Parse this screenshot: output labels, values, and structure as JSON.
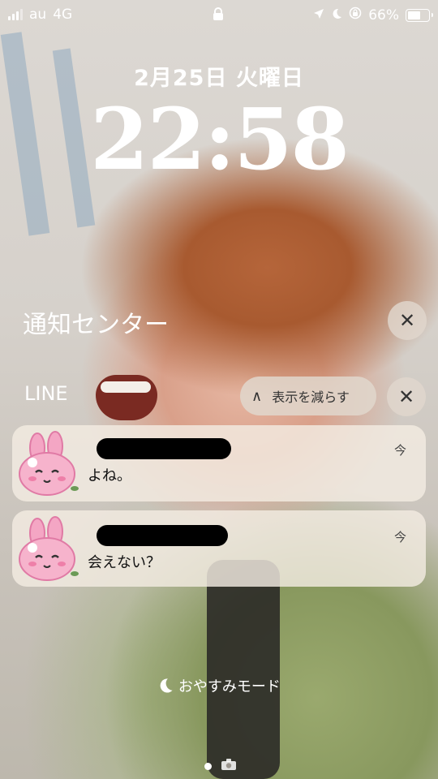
{
  "status_bar": {
    "carrier": "au",
    "network": "4G",
    "battery_percent": "66%",
    "battery_level": 0.66,
    "icons": [
      "signal-bars-icon",
      "lock-icon",
      "location-arrow-icon",
      "moon-icon",
      "rotation-lock-icon",
      "battery-icon"
    ]
  },
  "lock_screen": {
    "date": "2月25日 火曜日",
    "time": "22:58"
  },
  "notification_center": {
    "title": "通知センター",
    "group": {
      "app_name": "LINE",
      "show_less_label": "表示を減らす",
      "notifications": [
        {
          "sender": "",
          "message": "よね。",
          "time": "今"
        },
        {
          "sender": "",
          "message": "会えない？",
          "time": "今"
        }
      ]
    }
  },
  "focus_mode": {
    "label": "おやすみモード"
  },
  "colors": {
    "text": "#ffffff",
    "card": "#f3ece2",
    "pill": "#e1d7cd",
    "avatar_pink": "#f4a6c4"
  }
}
